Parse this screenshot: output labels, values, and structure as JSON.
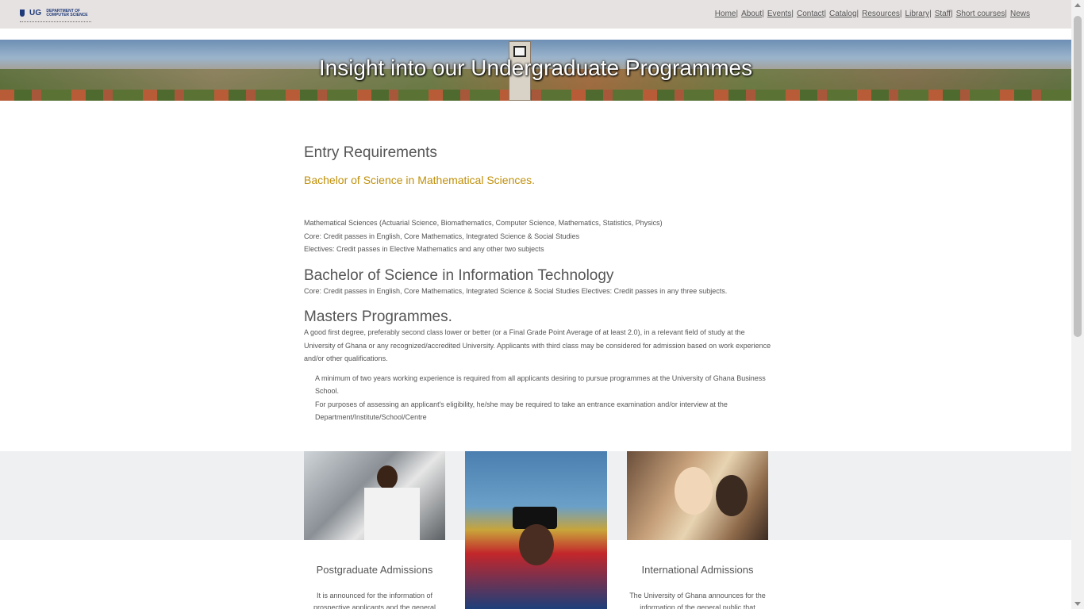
{
  "header": {
    "logo_mark": "UG",
    "logo_line1": "DEPARTMENT OF",
    "logo_line2": "COMPUTER SCIENCE",
    "nav": [
      "Home|",
      "About|",
      "Events|",
      "Contact|",
      "Catalog|",
      "Resources|",
      "Library|",
      "Staff|",
      "Short courses|",
      "News"
    ]
  },
  "banner": {
    "title": "Insight into our Undergraduate Programmes"
  },
  "main": {
    "entry_heading": "Entry Requirements",
    "bsc_math_title": "Bachelor of Science in Mathematical Sciences.",
    "math_lines": [
      "Mathematical Sciences (Actuarial Science, Biomathematics, Computer Science, Mathematics, Statistics, Physics)",
      "Core: Credit passes in English, Core Mathematics, Integrated Science & Social Studies",
      "Electives: Credit passes in Elective Mathematics and any other two subjects"
    ],
    "bsc_it_heading": "Bachelor of Science in Information Technology",
    "bsc_it_text": "Core: Credit passes in English, Core Mathematics, Integrated Science & Social Studies Electives: Credit passes in any three subjects.",
    "masters_heading": "Masters Programmes.",
    "masters_text": "A good first degree, preferably second class lower or better (or a Final Grade Point Average of at least 2.0), in a relevant field of study at the University of Ghana or any recognized/accredited University. Applicants with third class may be considered for admission based on work experience and/or other qualifications.",
    "masters_note1": "A minimum of two years working experience is required from all applicants desiring to pursue programmes at the University of Ghana Business School.",
    "masters_note2": "For purposes of assessing an applicant's eligibility, he/she may be required to take an entrance examination and/or interview at the Department/Institute/School/Centre"
  },
  "cards": {
    "postgrad_title": "Postgraduate Admissions",
    "postgrad_text": "It is announced for the information of prospective applicants and the general",
    "intl_title": "International Admissions",
    "intl_text": "The University of Ghana announces for the information of the general public that"
  }
}
